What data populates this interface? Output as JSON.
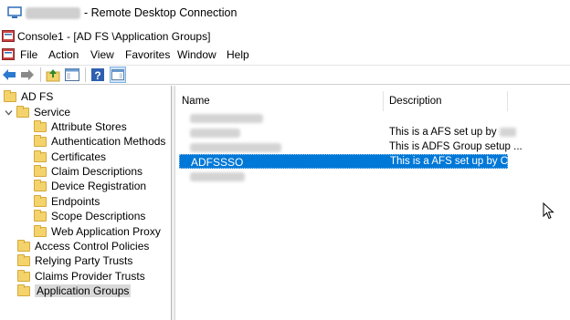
{
  "rdp": {
    "title": "- Remote Desktop Connection"
  },
  "mmc": {
    "title": "Console1 - [AD FS \\Application Groups]"
  },
  "menu": [
    "File",
    "Action",
    "View",
    "Favorites",
    "Window",
    "Help"
  ],
  "toolbar": {
    "icons": [
      "back-arrow-icon",
      "forward-arrow-icon",
      "up-folder-icon",
      "show-hide-console-tree-icon",
      "help-icon",
      "show-hide-action-pane-icon"
    ]
  },
  "tree": {
    "root": "AD FS",
    "service": "Service",
    "service_children": [
      "Attribute Stores",
      "Authentication Methods",
      "Certificates",
      "Claim Descriptions",
      "Device Registration",
      "Endpoints",
      "Scope Descriptions",
      "Web Application Proxy"
    ],
    "others": [
      "Access Control Policies",
      "Relying Party Trusts",
      "Claims Provider Trusts",
      "Application Groups"
    ],
    "selected": "Application Groups"
  },
  "list": {
    "columns": [
      "Name",
      "Description"
    ],
    "rows": [
      {
        "name": "",
        "description": ""
      },
      {
        "name": "",
        "description": "This is a AFS set up by"
      },
      {
        "name": "",
        "description": "This is ADFS Group setup ..."
      },
      {
        "name": "ADFSSSO",
        "description": "This is a AFS set up by CS ..."
      },
      {
        "name": "",
        "description": ""
      }
    ],
    "selected_index": 3
  },
  "colors": {
    "selection": "#0078d7",
    "folder": "#f4d36c"
  }
}
